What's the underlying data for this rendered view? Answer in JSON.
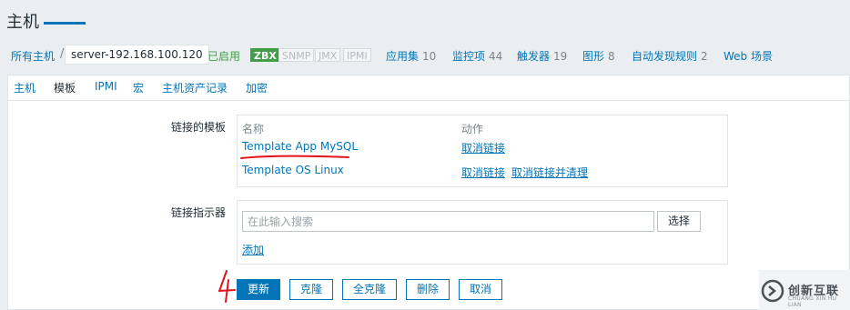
{
  "page": {
    "title": "主机"
  },
  "hostbar": {
    "all_hosts": "所有主机",
    "separator": "/",
    "host_name": "server-192.168.100.120",
    "status": "已启用",
    "badges": [
      "ZBX",
      "SNMP",
      "JMX",
      "IPMI"
    ],
    "links": [
      {
        "label": "应用集",
        "count": "10"
      },
      {
        "label": "监控项",
        "count": "44"
      },
      {
        "label": "触发器",
        "count": "19"
      },
      {
        "label": "图形",
        "count": "8"
      },
      {
        "label": "自动发现规则",
        "count": "2"
      },
      {
        "label": "Web 场景",
        "count": ""
      }
    ]
  },
  "tabs": [
    "主机",
    "模板",
    "IPMI",
    "宏",
    "主机资产记录",
    "加密"
  ],
  "active_tab": "模板",
  "form": {
    "linked_templates_label": "链接的模板",
    "col_name": "名称",
    "col_action": "动作",
    "templates": [
      {
        "name": "Template App MySQL",
        "actions": [
          "取消链接"
        ]
      },
      {
        "name": "Template OS Linux",
        "actions": [
          "取消链接",
          "取消链接并清理"
        ]
      }
    ],
    "link_indicator_label": "链接指示器",
    "search_placeholder": "在此输入搜索",
    "select_label": "选择",
    "add_label": "添加"
  },
  "buttons": {
    "update": "更新",
    "clone": "克隆",
    "full_clone": "全克隆",
    "delete": "删除",
    "cancel": "取消"
  },
  "watermark": {
    "text": "创新互联",
    "sub": "CHUANG XIN HU LIAN"
  },
  "colors": {
    "link": "#0275b8",
    "enabled": "#429e47",
    "annotation": "#e3141a"
  }
}
